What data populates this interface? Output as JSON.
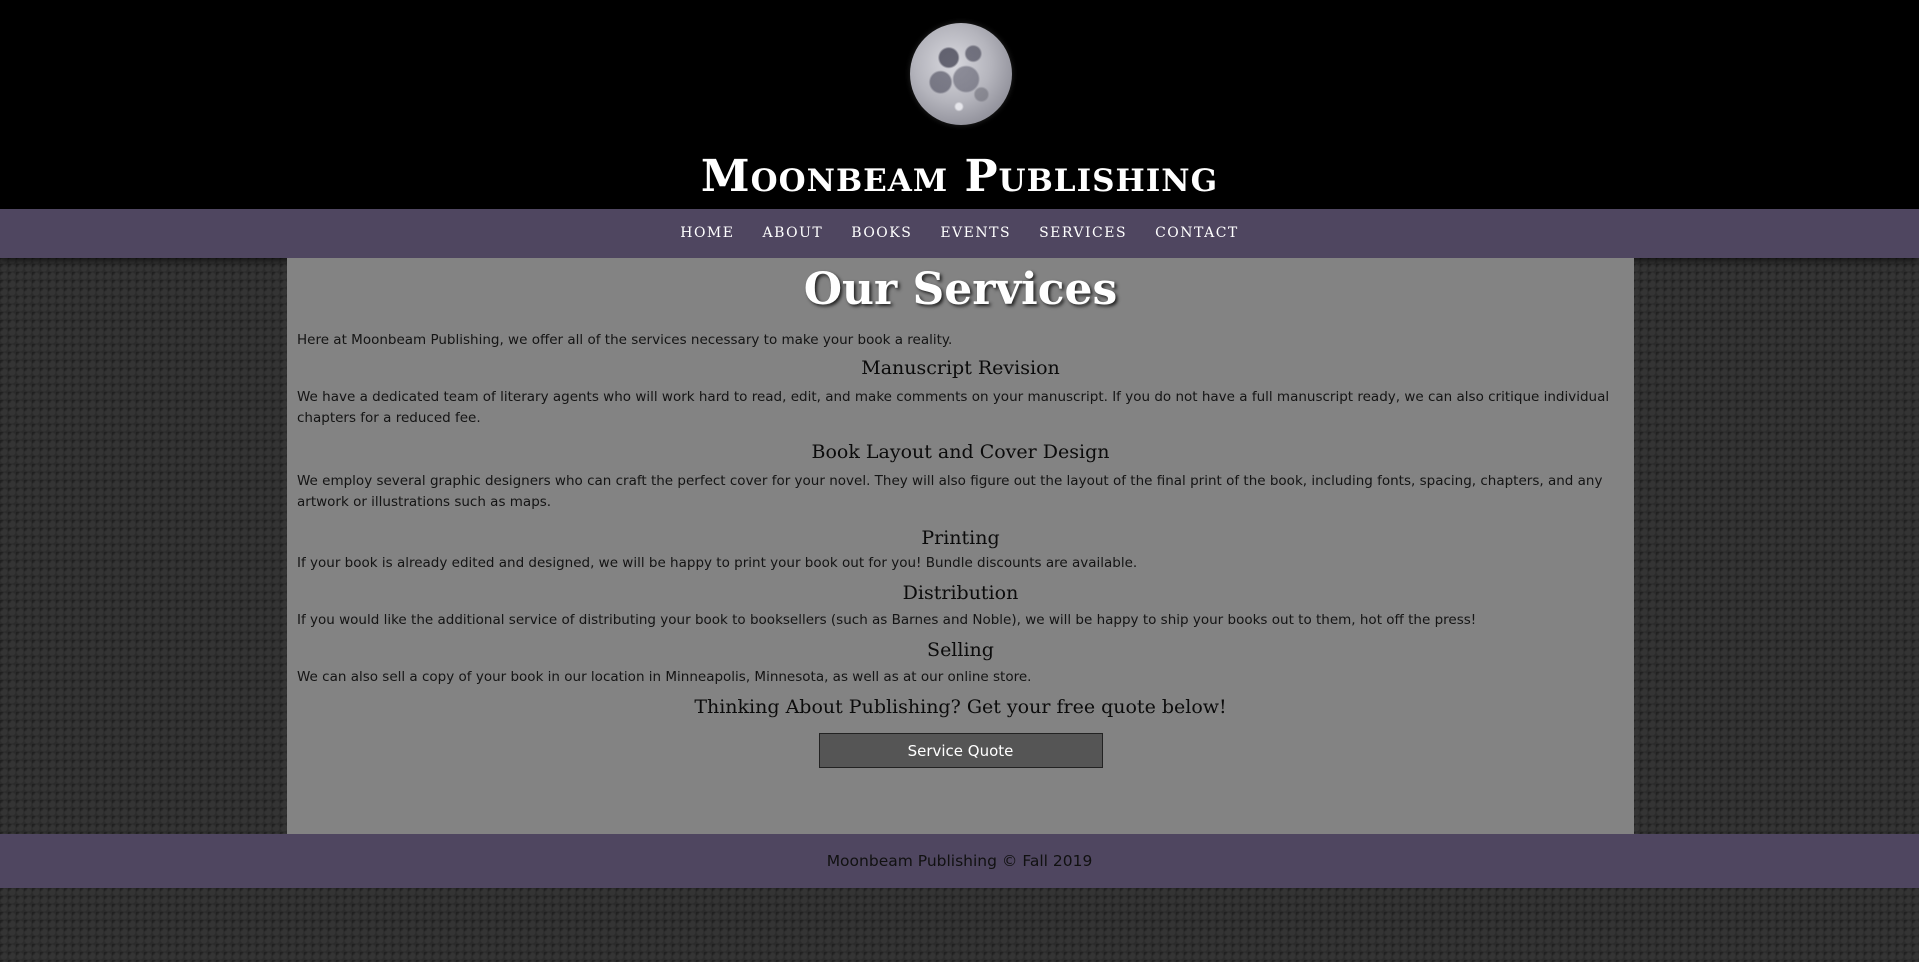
{
  "header": {
    "site_title": "Moonbeam Publishing",
    "logo_icon": "moon-icon"
  },
  "nav": {
    "items": [
      {
        "label": "HOME"
      },
      {
        "label": "ABOUT"
      },
      {
        "label": "BOOKS"
      },
      {
        "label": "EVENTS"
      },
      {
        "label": "SERVICES"
      },
      {
        "label": "CONTACT"
      }
    ]
  },
  "main": {
    "title": "Our Services",
    "intro": "Here at Moonbeam Publishing, we offer all of the services necessary to make your book a reality.",
    "sections": [
      {
        "heading": "Manuscript Revision",
        "text": "We have a dedicated team of literary agents who will work hard to read, edit, and make comments on your manuscript. If you do not have a full manuscript ready, we can also critique individual chapters for a reduced fee."
      },
      {
        "heading": "Book Layout and Cover Design",
        "text": "We employ several graphic designers who can craft the perfect cover for your novel. They will also figure out the layout of the final print of the book, including fonts, spacing, chapters, and any artwork or illustrations such as maps."
      },
      {
        "heading": "Printing",
        "text": "If your book is already edited and designed, we will be happy to print your book out for you! Bundle discounts are available."
      },
      {
        "heading": "Distribution",
        "text": "If you would like the additional service of distributing your book to booksellers (such as Barnes and Noble), we will be happy to ship your books out to them, hot off the press!"
      },
      {
        "heading": "Selling",
        "text": "We can also sell a copy of your book in our location in Minneapolis, Minnesota, as well as at our online store."
      }
    ],
    "cta_heading": "Thinking About Publishing? Get your free quote below!",
    "cta_button": "Service Quote"
  },
  "footer": {
    "text": "Moonbeam Publishing © Fall 2019"
  },
  "colors": {
    "header_bg": "#000000",
    "nav_bg": "#4f4660",
    "content_bg": "#838383",
    "button_bg": "#555555"
  }
}
